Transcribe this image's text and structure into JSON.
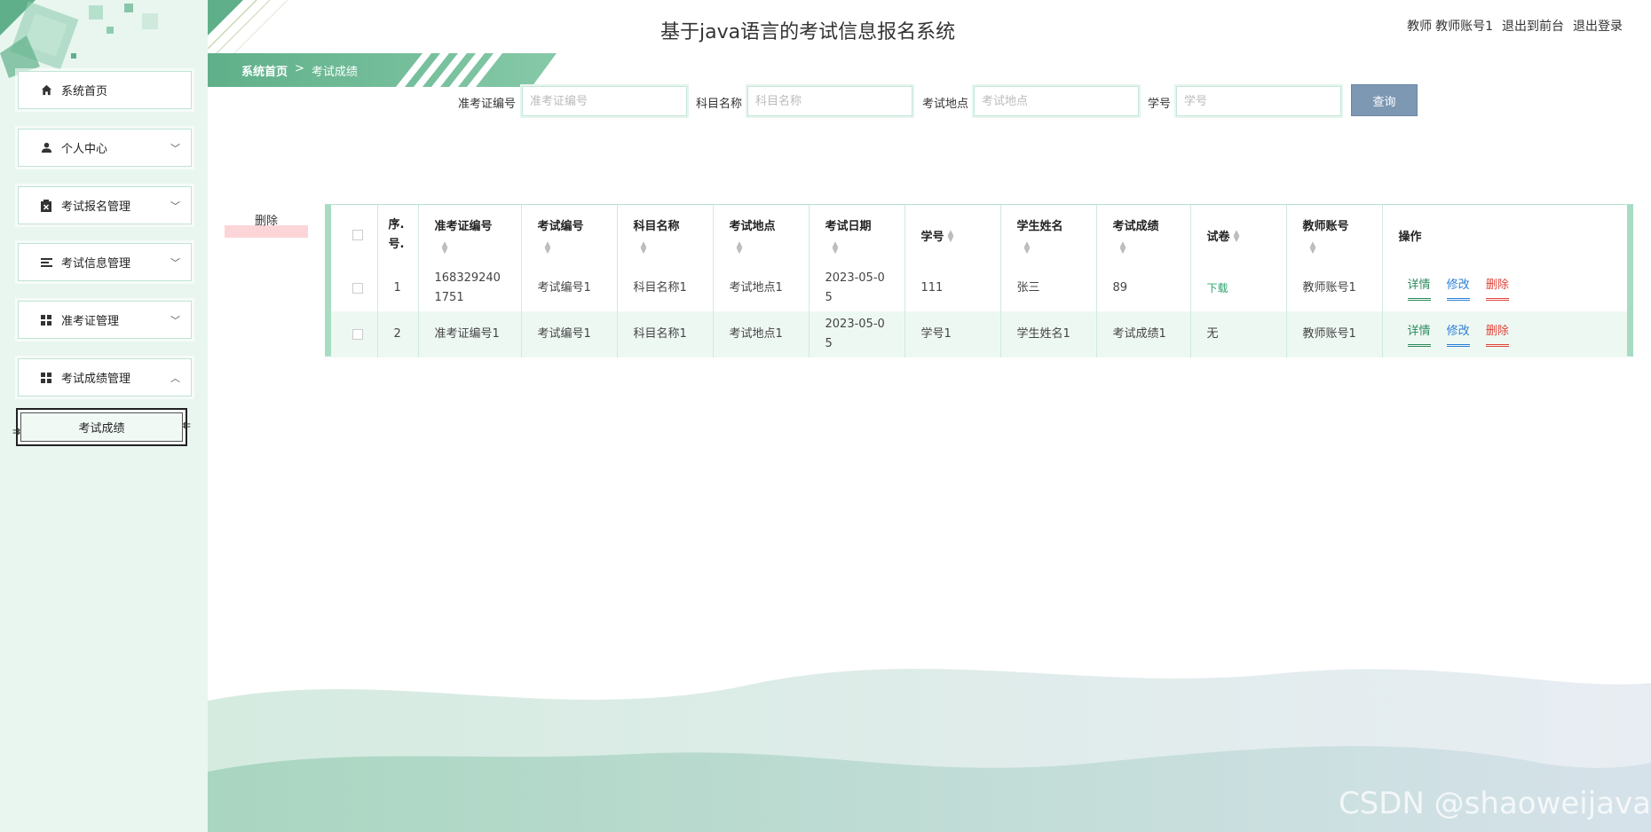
{
  "header": {
    "title": "基于java语言的考试信息报名系统",
    "user_role": "教师",
    "user_account": "教师账号1",
    "to_front": "退出到前台",
    "logout": "退出登录"
  },
  "breadcrumb": {
    "home": "系统首页",
    "separator": ">",
    "current": "考试成绩"
  },
  "sidebar": {
    "items": [
      {
        "label": "系统首页",
        "icon": "home-icon"
      },
      {
        "label": "个人中心",
        "icon": "user-icon"
      },
      {
        "label": "考试报名管理",
        "icon": "clipboard-icon"
      },
      {
        "label": "考试信息管理",
        "icon": "list-icon"
      },
      {
        "label": "准考证管理",
        "icon": "grid-icon"
      },
      {
        "label": "考试成绩管理",
        "icon": "grid-icon"
      }
    ],
    "sub_item": "考试成绩"
  },
  "search": {
    "ticket_label": "准考证编号",
    "ticket_placeholder": "准考证编号",
    "subject_label": "科目名称",
    "subject_placeholder": "科目名称",
    "location_label": "考试地点",
    "location_placeholder": "考试地点",
    "student_label": "学号",
    "student_placeholder": "学号",
    "query_button": "查询"
  },
  "batch_delete": "删除",
  "table": {
    "headers": [
      "序.号.",
      "准考证编号",
      "考试编号",
      "科目名称",
      "考试地点",
      "考试日期",
      "学号",
      "学生姓名",
      "考试成绩",
      "试卷",
      "教师账号",
      "操作"
    ],
    "rows": [
      {
        "index": "1",
        "ticket": "1683292401751",
        "exam_no": "考试编号1",
        "subject": "科目名称1",
        "location": "考试地点1",
        "date": "2023-05-05",
        "student_no": "111",
        "student_name": "张三",
        "score": "89",
        "paper": "下载",
        "teacher": "教师账号1"
      },
      {
        "index": "2",
        "ticket": "准考证编号1",
        "exam_no": "考试编号1",
        "subject": "科目名称1",
        "location": "考试地点1",
        "date": "2023-05-05",
        "student_no": "学号1",
        "student_name": "学生姓名1",
        "score": "考试成绩1",
        "paper": "无",
        "teacher": "教师账号1"
      }
    ],
    "actions": {
      "detail": "详情",
      "edit": "修改",
      "delete": "删除"
    }
  },
  "watermark": "CSDN @shaoweijava",
  "colors": {
    "accent": "#5fb08a",
    "query_button": "#7d98b3",
    "sidebar_bg": "#e9f6f0"
  }
}
